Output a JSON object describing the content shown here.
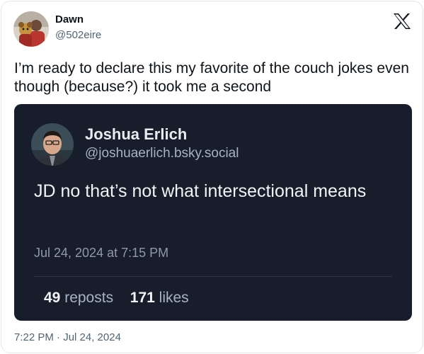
{
  "tweet": {
    "author_name": "Dawn",
    "author_handle": "@502eire",
    "text": "I’m ready to declare this my favorite of the couch jokes even though (because?) it took me a second",
    "timestamp": "7:22 PM · Jul 24, 2024"
  },
  "icons": {
    "x_logo": "x-logo-icon"
  },
  "quoted": {
    "author_name": "Joshua Erlich",
    "author_handle": "@joshuaerlich.bsky.social",
    "text": "JD no that’s not what intersectional means",
    "date": "Jul 24, 2024 at 7:15 PM",
    "reposts_count": "49",
    "reposts_label": "reposts",
    "likes_count": "171",
    "likes_label": "likes"
  },
  "colors": {
    "quoted_background": "#171d2a",
    "text_primary": "#0f1419",
    "text_secondary": "#536471"
  }
}
